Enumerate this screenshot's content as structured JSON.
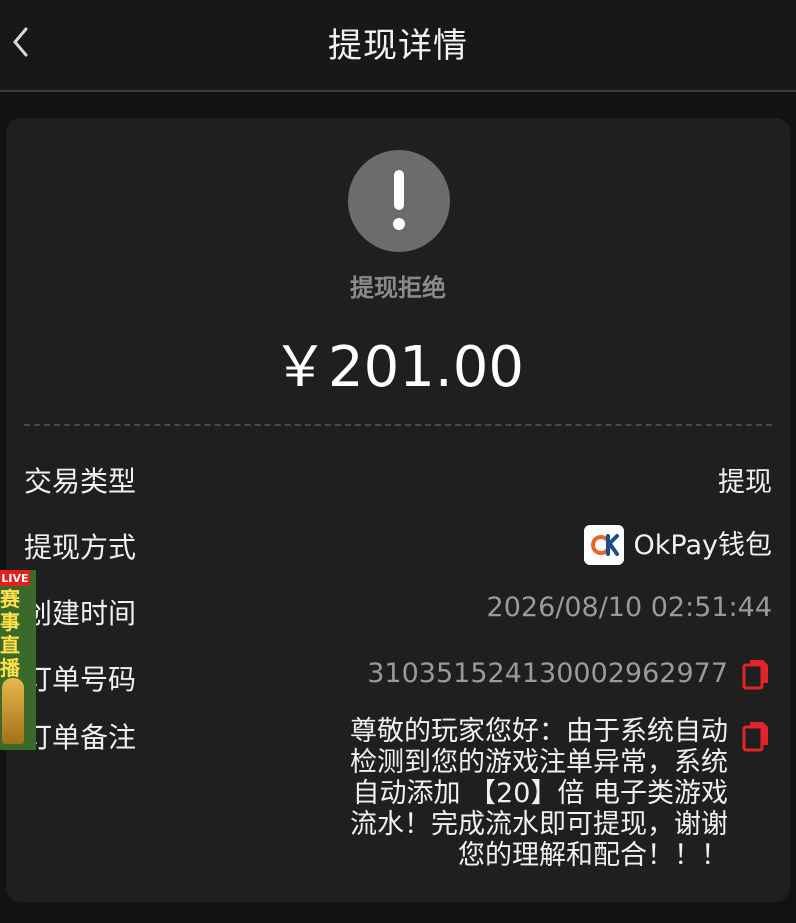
{
  "header": {
    "back_icon": "chevron-left-icon",
    "title": "提现详情"
  },
  "status": {
    "icon": "exclamation-icon",
    "text": "提现拒绝",
    "amount": "￥201.00"
  },
  "details": {
    "type": {
      "label": "交易类型",
      "value": "提现"
    },
    "method": {
      "label": "提现方式",
      "value": "OkPay钱包",
      "icon": "okpay-logo"
    },
    "created": {
      "label": "创建时间",
      "value": "2026/08/10 02:51:44"
    },
    "order_no": {
      "label": "订单号码",
      "value": "310351524130002962977",
      "copy_icon": "copy-icon"
    },
    "remark": {
      "label": "订单备注",
      "lines": [
        "尊敬的玩家您好：由于系统自动",
        "检测到您的游戏注单异常，系统",
        "自动添加 【20】倍 电子类游戏",
        "流水！完成流水即可提现，谢谢",
        "您的理解和配合！！！"
      ],
      "copy_icon": "copy-icon"
    }
  },
  "overlay": {
    "live_tag": "LIVE",
    "chars": [
      "赛",
      "事",
      "直",
      "播"
    ]
  },
  "colors": {
    "background": "#121212",
    "card": "#1f1f1f",
    "status_icon": "#6c6c6c",
    "copy_icon": "#e0242a",
    "okpay_brand": "#e8642a"
  }
}
